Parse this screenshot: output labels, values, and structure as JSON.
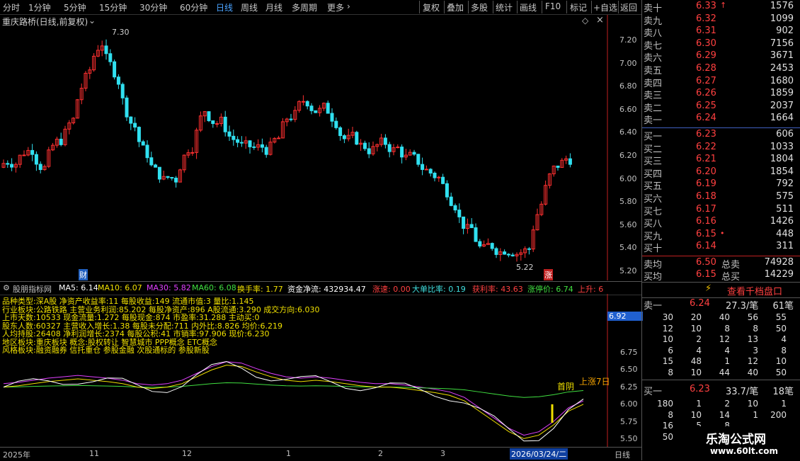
{
  "toolbar": {
    "left_items": [
      "分时",
      "1分钟",
      "5分钟",
      "15分钟",
      "30分钟",
      "60分钟",
      "日线",
      "周线",
      "月线",
      "多周期",
      "更多"
    ],
    "active": "日线",
    "right_items": [
      "复权",
      "叠加",
      "多股",
      "统计",
      "画线",
      "F10",
      "标记",
      "+自选",
      "返回"
    ]
  },
  "main_chart": {
    "title": "重庆路桥(日线,前复权)",
    "y_ticks": [
      "7.20",
      "7.00",
      "6.80",
      "6.60",
      "6.40",
      "6.20",
      "6.00",
      "5.80",
      "5.60",
      "5.40",
      "5.20"
    ],
    "high_label": "7.30",
    "low_label": "5.22",
    "marker_cai": "财",
    "marker_zhang": "涨"
  },
  "indicator_header": {
    "name": "股朋指标网",
    "items": [
      {
        "text": "MA5: 6.14",
        "color": "#ffffff"
      },
      {
        "text": "MA10: 6.07",
        "color": "#f0e000"
      },
      {
        "text": "MA30: 5.82",
        "color": "#e040ff"
      },
      {
        "text": "MA60: 6.08",
        "color": "#40e040"
      },
      {
        "text": "换手率: 1.77",
        "color": "#f0e000"
      },
      {
        "text": "资金净流: 432934.47",
        "color": "#ffffff"
      },
      {
        "text": "涨速: 0.00",
        "color": "#ff4040"
      },
      {
        "text": "大单比率: 0.19",
        "color": "#40e0e0"
      },
      {
        "text": "获利率: 43.63",
        "color": "#ff4040"
      },
      {
        "text": "涨停价: 6.74",
        "color": "#40e040"
      },
      {
        "text": "上升: 6",
        "color": "#ff4040"
      }
    ]
  },
  "indicator_chart": {
    "y_ticks": [
      "6.75",
      "6.50",
      "6.25",
      "6.00",
      "5.75",
      "5.50"
    ],
    "current_value": "6.92",
    "info_lines": [
      "品种类型:深A股 净资产收益率:11 每股收益:149 流通市值:3 量比:1.145",
      "行业板块:公路铁路 主营业务利润:85.202 每股净资产:896 A股流通:3.290 成交方向:6.030",
      "上市天数:10533 现金流量:1.272 每股现金:874 市盈率:31.288 主动买:0",
      "股东人数:60327 主营收入增长:1.38 每股未分配:711 内外比:8.826 均价:6.219",
      "人均持股:26408 净利润增长:2374 每股公积:41 市销率:97.906 现价:6.230",
      "地区板块:重庆板块 概念:股权转让 智慧城市 PPP概念 ETC概念",
      "风格板块:融资融券 信托重仓 参股金融 次股通标的 参股新股"
    ],
    "label_first_yin": "首阴",
    "label_rise": "上涨7日"
  },
  "date_axis": {
    "labels": [
      "2025年",
      "11",
      "12",
      "1",
      "2",
      "3"
    ],
    "cursor_date": "2026/03/24/二",
    "period": "日线"
  },
  "order_book": {
    "sells": [
      {
        "label": "卖十",
        "price": "6.33",
        "vol": "1576",
        "flag": "↑"
      },
      {
        "label": "卖九",
        "price": "6.32",
        "vol": "1099"
      },
      {
        "label": "卖八",
        "price": "6.31",
        "vol": "902"
      },
      {
        "label": "卖七",
        "price": "6.30",
        "vol": "7156"
      },
      {
        "label": "卖六",
        "price": "6.29",
        "vol": "3671"
      },
      {
        "label": "卖五",
        "price": "6.28",
        "vol": "2453"
      },
      {
        "label": "卖四",
        "price": "6.27",
        "vol": "1680"
      },
      {
        "label": "卖三",
        "price": "6.26",
        "vol": "1859"
      },
      {
        "label": "卖二",
        "price": "6.25",
        "vol": "2037"
      },
      {
        "label": "卖一",
        "price": "6.24",
        "vol": "1664"
      }
    ],
    "buys": [
      {
        "label": "买一",
        "price": "6.23",
        "vol": "606"
      },
      {
        "label": "买二",
        "price": "6.22",
        "vol": "1033"
      },
      {
        "label": "买三",
        "price": "6.21",
        "vol": "1804"
      },
      {
        "label": "买四",
        "price": "6.20",
        "vol": "1854"
      },
      {
        "label": "买五",
        "price": "6.19",
        "vol": "792"
      },
      {
        "label": "买六",
        "price": "6.18",
        "vol": "575"
      },
      {
        "label": "买七",
        "price": "6.17",
        "vol": "511"
      },
      {
        "label": "买八",
        "price": "6.16",
        "vol": "1426"
      },
      {
        "label": "买九",
        "price": "6.15",
        "vol": "448",
        "flag": "•"
      },
      {
        "label": "买十",
        "price": "6.14",
        "vol": "311"
      }
    ],
    "avg_sell": {
      "label": "卖均",
      "price": "6.50",
      "total_label": "总卖",
      "total": "74928"
    },
    "avg_buy": {
      "label": "买均",
      "price": "6.15",
      "total_label": "总买",
      "total": "14229"
    }
  },
  "queue": {
    "button": "查看千档盘口",
    "sell1": {
      "label": "卖一",
      "price": "6.24",
      "avg": "27.3/笔",
      "count": "61笔"
    },
    "sell1_rows": [
      [
        "30",
        "20",
        "40",
        "56",
        "55"
      ],
      [
        "12",
        "10",
        "8",
        "8",
        "50"
      ],
      [
        "10",
        "2",
        "12",
        "13",
        "4"
      ],
      [
        "6",
        "4",
        "4",
        "3",
        "8"
      ],
      [
        "15",
        "48",
        "1",
        "12",
        "10"
      ],
      [
        "8",
        "10",
        "44",
        "40",
        "50"
      ]
    ],
    "buy1": {
      "label": "买一",
      "price": "6.23",
      "avg": "33.7/笔",
      "count": "18笔"
    },
    "buy1_rows": [
      [
        "180",
        "1",
        "2",
        "10",
        "1"
      ],
      [
        "8",
        "10",
        "14",
        "1",
        "200"
      ],
      [
        "16",
        "5",
        "8",
        "",
        ""
      ],
      [
        "50",
        "",
        "",
        "",
        ""
      ]
    ]
  },
  "watermark": {
    "title": "乐淘公式网",
    "url": "www.60lt.com"
  },
  "colors": {
    "up": "#ff3030",
    "down": "#30e0f0",
    "ma5": "#ffffff",
    "ma10": "#f0e000",
    "ma30": "#e040ff",
    "ma60": "#40e040",
    "accent": "#4aa3ff"
  }
}
